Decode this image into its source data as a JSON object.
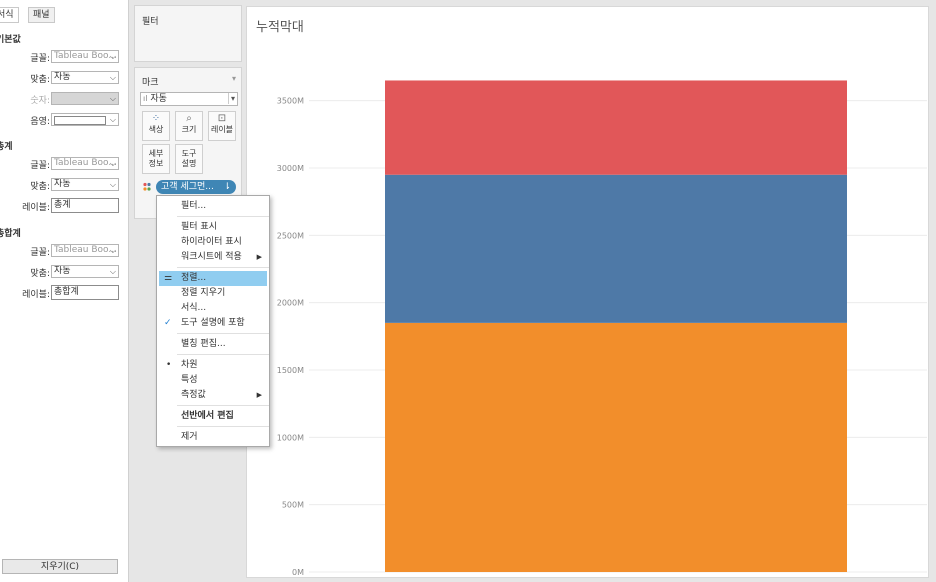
{
  "format_pane": {
    "tabs": [
      "서식",
      "패널"
    ],
    "sections": [
      {
        "heading": "기본값",
        "rows": [
          {
            "label": "글꼴:",
            "value": "Tableau Boo...",
            "type": "select",
            "placeholder": true
          },
          {
            "label": "맞춤:",
            "value": "자동",
            "type": "select"
          },
          {
            "label": "숫자:",
            "value": "",
            "type": "select",
            "disabled": true
          },
          {
            "label": "음영:",
            "value": "",
            "type": "select"
          }
        ]
      },
      {
        "heading": "총계",
        "rows": [
          {
            "label": "글꼴:",
            "value": "Tableau Boo...",
            "type": "select",
            "placeholder": true
          },
          {
            "label": "맞춤:",
            "value": "자동",
            "type": "select"
          },
          {
            "label": "레이블:",
            "value": "총계",
            "type": "text"
          }
        ]
      },
      {
        "heading": "총합계",
        "rows": [
          {
            "label": "글꼴:",
            "value": "Tableau Boo...",
            "type": "select",
            "placeholder": true
          },
          {
            "label": "맞춤:",
            "value": "자동",
            "type": "select"
          },
          {
            "label": "레이블:",
            "value": "총합계",
            "type": "text"
          }
        ]
      }
    ],
    "clear_button": "지우기(C)"
  },
  "filters_card": {
    "title": "필터"
  },
  "marks_card": {
    "title": "마크",
    "mark_type": "자동",
    "buttons": [
      {
        "label": "색상",
        "icon": "color-dots-icon"
      },
      {
        "label": "크기",
        "icon": "size-icon"
      },
      {
        "label": "레이블",
        "icon": "label-icon"
      },
      {
        "label": "세부\n정보",
        "icon": ""
      },
      {
        "label": "도구\n설명",
        "icon": ""
      }
    ],
    "pill": "고객 세그먼...",
    "colors": {
      "pill": "#3f86b5"
    }
  },
  "context_menu": {
    "items": [
      {
        "label": "필터...",
        "group": 0
      },
      {
        "label": "필터 표시",
        "group": 1
      },
      {
        "label": "하이라이터 표시",
        "group": 1
      },
      {
        "label": "워크시트에 적용",
        "group": 1,
        "submenu": true
      },
      {
        "label": "정렬...",
        "group": 2,
        "highlighted": true,
        "icon": "sort-icon"
      },
      {
        "label": "정렬 지우기",
        "group": 2
      },
      {
        "label": "서식...",
        "group": 2
      },
      {
        "label": "도구 설명에 포함",
        "group": 2,
        "checked": true
      },
      {
        "label": "별칭 편집...",
        "group": 3
      },
      {
        "label": "차원",
        "group": 4,
        "radio": true
      },
      {
        "label": "특성",
        "group": 4
      },
      {
        "label": "측정값",
        "group": 4,
        "submenu": true
      },
      {
        "label": "선반에서 편집",
        "group": 5,
        "bold": true
      },
      {
        "label": "제거",
        "group": 6
      }
    ],
    "colors": {
      "highlight": "#90cdf0",
      "check": "#1f7ed0"
    }
  },
  "chart_data": {
    "type": "bar",
    "title": "누적막대",
    "categories": [
      ""
    ],
    "series": [
      {
        "values": [
          1850
        ],
        "color": "#f28e2b"
      },
      {
        "values": [
          1100
        ],
        "color": "#4e79a7"
      },
      {
        "values": [
          700
        ],
        "color": "#e15759"
      }
    ],
    "ylim": [
      0,
      3750
    ],
    "yticks": [
      "0M",
      "500M",
      "1000M",
      "1500M",
      "2000M",
      "2500M",
      "3000M",
      "3500M"
    ],
    "grid": true
  }
}
